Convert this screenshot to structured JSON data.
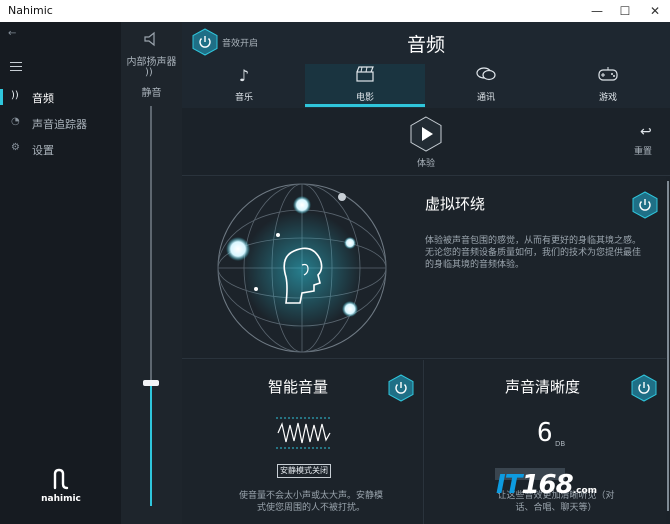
{
  "window": {
    "title": "Nahimic",
    "min": "—",
    "max": "☐",
    "close": "✕"
  },
  "sidebar": {
    "back": "←",
    "items": [
      {
        "label": "音频",
        "icon": "audio-wave-icon",
        "active": true
      },
      {
        "label": "声音追踪器",
        "icon": "sound-tracker-icon",
        "active": false
      },
      {
        "label": "设置",
        "icon": "gear-icon",
        "active": false
      }
    ],
    "logo_mark": "ก",
    "logo_word": "nahimic"
  },
  "volume": {
    "device_label": "内部扬声器",
    "mute_label": "静音",
    "level": 0.3
  },
  "header": {
    "effect_label": "音效开启",
    "title": "音频",
    "tabs": [
      {
        "label": "音乐",
        "icon": "music-note-icon",
        "glyph": "♪"
      },
      {
        "label": "电影",
        "icon": "clapperboard-icon",
        "glyph": "🎬"
      },
      {
        "label": "通讯",
        "icon": "chat-bubble-icon",
        "glyph": "💬"
      },
      {
        "label": "游戏",
        "icon": "gamepad-icon",
        "glyph": "🎮"
      }
    ],
    "active_tab": 1
  },
  "actions": {
    "play_label": "体验",
    "reset_label": "重置",
    "reset_glyph": "↩"
  },
  "surround": {
    "title": "虚拟环绕",
    "desc": [
      "体验被声音包围的感觉，从而有更好的身临其境之感。",
      "无论您的音频设备质量如何，我们的技术为您提供最佳",
      "的身临其境的音频体验。"
    ]
  },
  "smart_volume": {
    "title": "智能音量",
    "mode_button": "安静模式关闭",
    "desc": [
      "使音量不会太小声或太大声。安静模",
      "式使您周围的人不被打扰。"
    ]
  },
  "clarity": {
    "title": "声音清晰度",
    "value": "6",
    "unit": "DB",
    "desc": [
      "让这些音效更加清晰听见（对",
      "话、合唱、聊天等）"
    ]
  },
  "watermark": {
    "prefix": "IT",
    "number": "168",
    "suffix": ".com"
  },
  "colors": {
    "accent": "#2fc6dc",
    "background": "#1a2027",
    "hex_button": "#1f6f86"
  }
}
